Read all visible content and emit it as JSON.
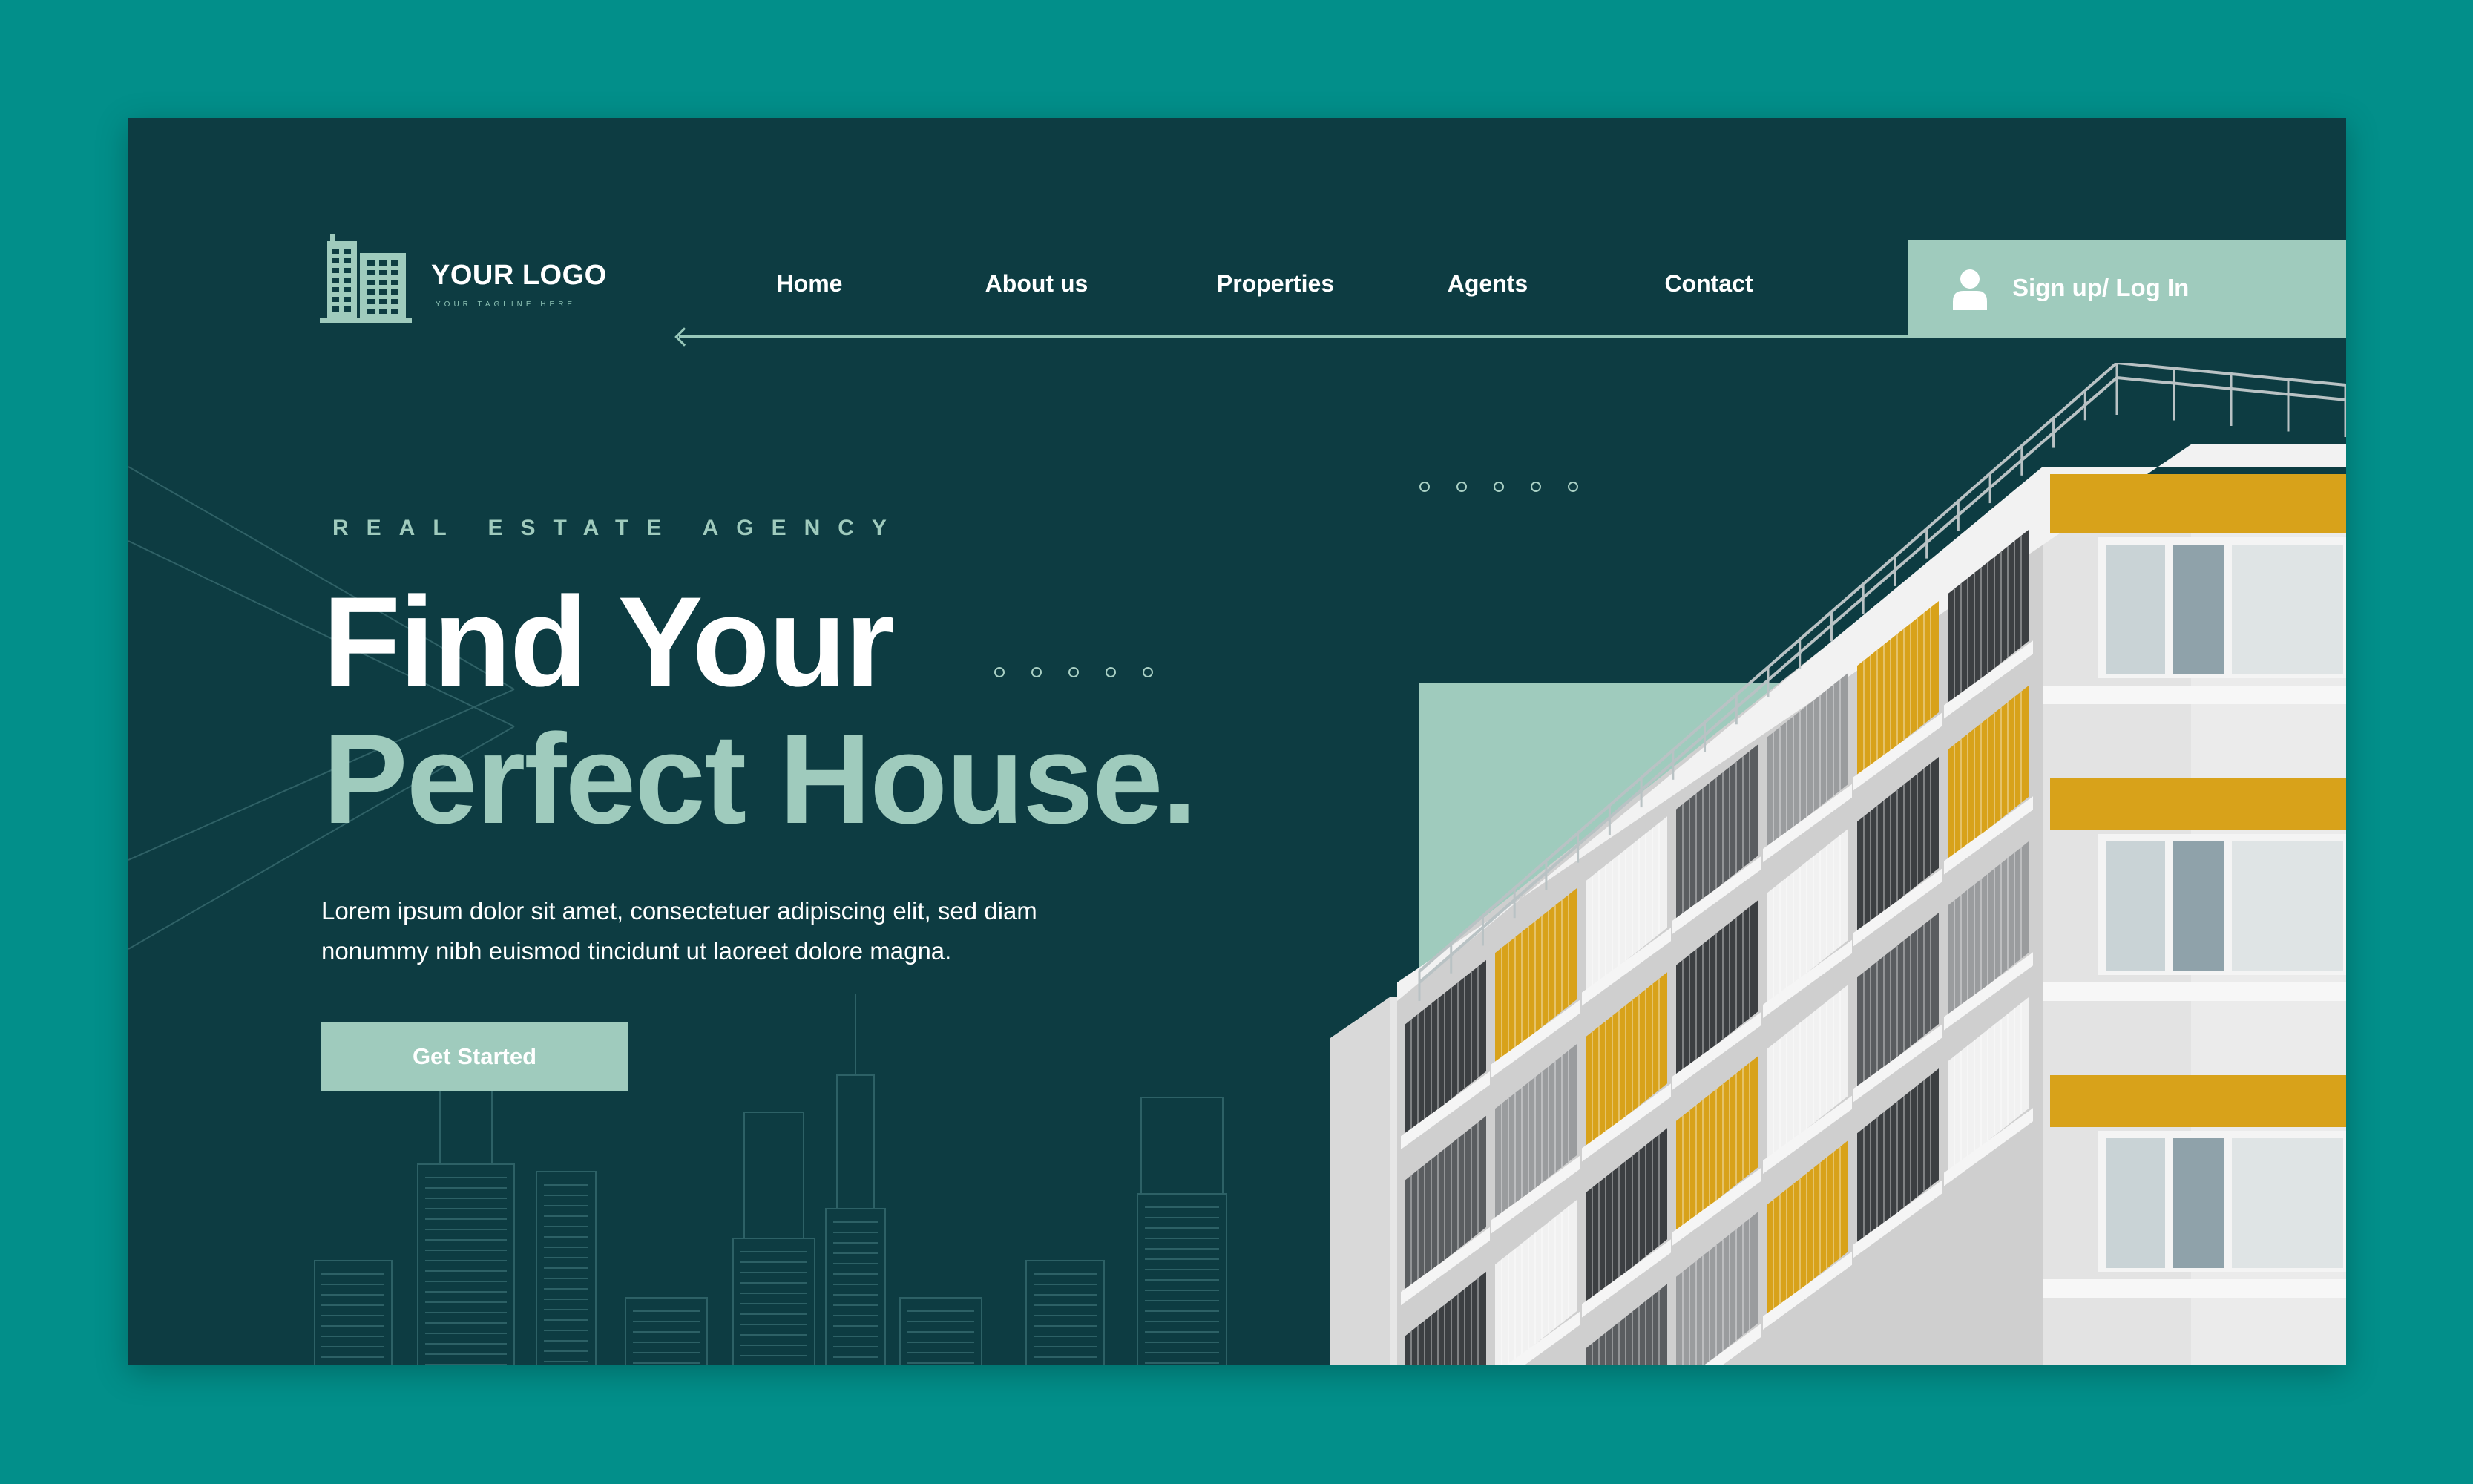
{
  "colors": {
    "page_background": "#028f8a",
    "card_background": "#0d3c42",
    "accent": "#9fcbbd",
    "text": "#ffffff"
  },
  "logo": {
    "name": "YOUR LOGO",
    "tagline": "YOUR TAGLINE HERE",
    "icon": "buildings-icon"
  },
  "nav": {
    "items": [
      "Home",
      "About us",
      "Properties",
      "Agents",
      "Contact"
    ],
    "back_icon": "arrow-left-icon"
  },
  "signup": {
    "label": "Sign up/ Log In",
    "icon": "user-icon"
  },
  "hero": {
    "eyebrow": "REAL ESTATE AGENCY",
    "title_line1": "Find Your",
    "title_line2": "Perfect House.",
    "description_line1": "Lorem ipsum dolor sit amet, consectetuer adipiscing elit, sed diam",
    "description_line2": "nonummy nibh euismod tincidunt ut laoreet dolore magna.",
    "cta_label": "Get Started"
  },
  "decor": {
    "skyline": "city-skyline-outline",
    "photo": "apartment-building-photo"
  }
}
